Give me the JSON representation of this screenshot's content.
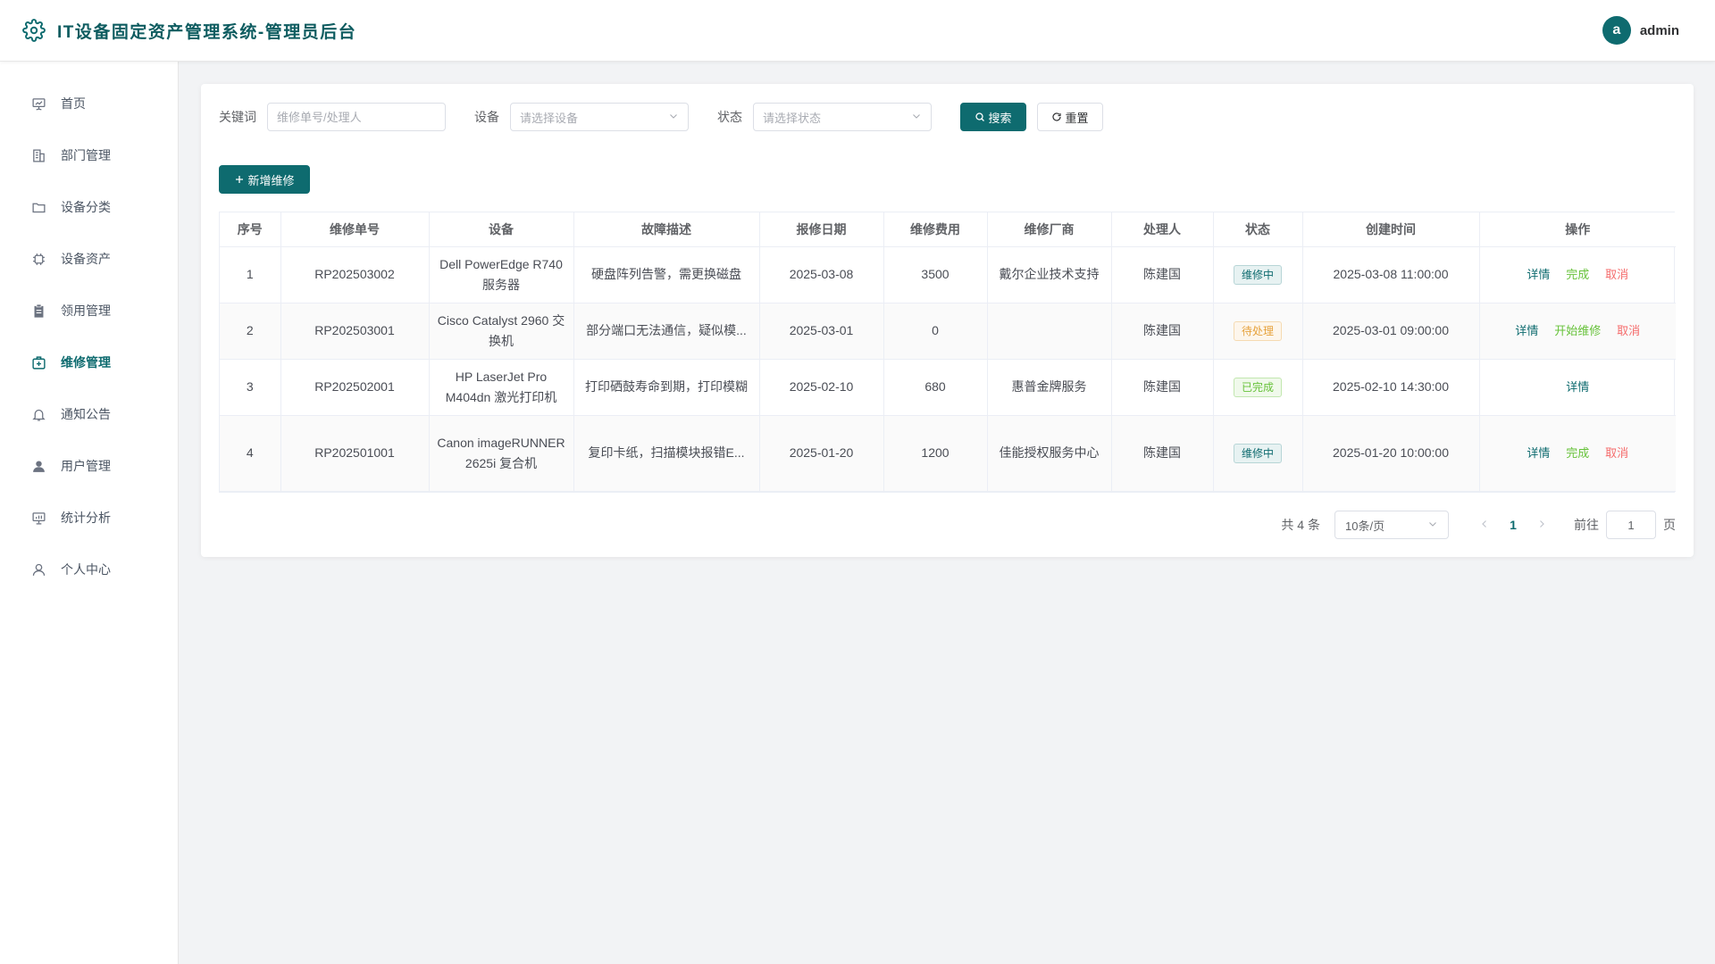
{
  "app": {
    "title": "IT设备固定资产管理系统-管理员后台"
  },
  "user": {
    "avatar_letter": "a",
    "name": "admin"
  },
  "colors": {
    "primary": "#0e6b6f",
    "success": "#67c23a",
    "warning": "#e6a23c",
    "danger": "#f56c6c"
  },
  "sidebar": {
    "items": [
      {
        "label": "首页",
        "icon": "dashboard-icon"
      },
      {
        "label": "部门管理",
        "icon": "building-icon"
      },
      {
        "label": "设备分类",
        "icon": "folder-icon"
      },
      {
        "label": "设备资产",
        "icon": "chip-icon"
      },
      {
        "label": "领用管理",
        "icon": "clipboard-icon"
      },
      {
        "label": "维修管理",
        "icon": "repair-kit-icon",
        "active": true
      },
      {
        "label": "通知公告",
        "icon": "bell-icon"
      },
      {
        "label": "用户管理",
        "icon": "user-filled-icon"
      },
      {
        "label": "统计分析",
        "icon": "chart-board-icon"
      },
      {
        "label": "个人中心",
        "icon": "user-icon"
      }
    ]
  },
  "filters": {
    "keyword_label": "关键词",
    "keyword_placeholder": "维修单号/处理人",
    "keyword_value": "",
    "device_label": "设备",
    "device_placeholder": "请选择设备",
    "status_label": "状态",
    "status_placeholder": "请选择状态",
    "search_label": "搜索",
    "reset_label": "重置"
  },
  "toolbar": {
    "add_label": "新增维修"
  },
  "table": {
    "columns": [
      "序号",
      "维修单号",
      "设备",
      "故障描述",
      "报修日期",
      "维修费用",
      "维修厂商",
      "处理人",
      "状态",
      "创建时间",
      "操作"
    ],
    "rows": [
      {
        "index": "1",
        "order_no": "RP202503002",
        "device": "Dell PowerEdge R740 服务器",
        "fault": "硬盘阵列告警，需更换磁盘",
        "report_date": "2025-03-08",
        "cost": "3500",
        "vendor": "戴尔企业技术支持",
        "handler": "陈建国",
        "status": "维修中",
        "status_type": "info",
        "created_at": "2025-03-08 11:00:00",
        "actions": [
          {
            "label": "详情",
            "type": "primary"
          },
          {
            "label": "完成",
            "type": "success"
          },
          {
            "label": "取消",
            "type": "danger"
          }
        ]
      },
      {
        "index": "2",
        "order_no": "RP202503001",
        "device": "Cisco Catalyst 2960 交换机",
        "fault": "部分端口无法通信，疑似模...",
        "report_date": "2025-03-01",
        "cost": "0",
        "vendor": "",
        "handler": "陈建国",
        "status": "待处理",
        "status_type": "warning",
        "created_at": "2025-03-01 09:00:00",
        "actions": [
          {
            "label": "详情",
            "type": "primary"
          },
          {
            "label": "开始维修",
            "type": "success"
          },
          {
            "label": "取消",
            "type": "danger"
          }
        ]
      },
      {
        "index": "3",
        "order_no": "RP202502001",
        "device": "HP LaserJet Pro M404dn 激光打印机",
        "fault": "打印硒鼓寿命到期，打印模糊",
        "report_date": "2025-02-10",
        "cost": "680",
        "vendor": "惠普金牌服务",
        "handler": "陈建国",
        "status": "已完成",
        "status_type": "success",
        "created_at": "2025-02-10 14:30:00",
        "actions": [
          {
            "label": "详情",
            "type": "primary"
          }
        ]
      },
      {
        "index": "4",
        "order_no": "RP202501001",
        "device": "Canon imageRUNNER 2625i 复合机",
        "fault": "复印卡纸，扫描模块报错E...",
        "report_date": "2025-01-20",
        "cost": "1200",
        "vendor": "佳能授权服务中心",
        "handler": "陈建国",
        "status": "维修中",
        "status_type": "info",
        "created_at": "2025-01-20 10:00:00",
        "actions": [
          {
            "label": "详情",
            "type": "primary"
          },
          {
            "label": "完成",
            "type": "success"
          },
          {
            "label": "取消",
            "type": "danger"
          }
        ]
      }
    ]
  },
  "pagination": {
    "total_text": "共 4 条",
    "page_size": "10条/页",
    "current_page": "1",
    "goto_label": "前往",
    "goto_value": "1",
    "page_unit": "页"
  }
}
